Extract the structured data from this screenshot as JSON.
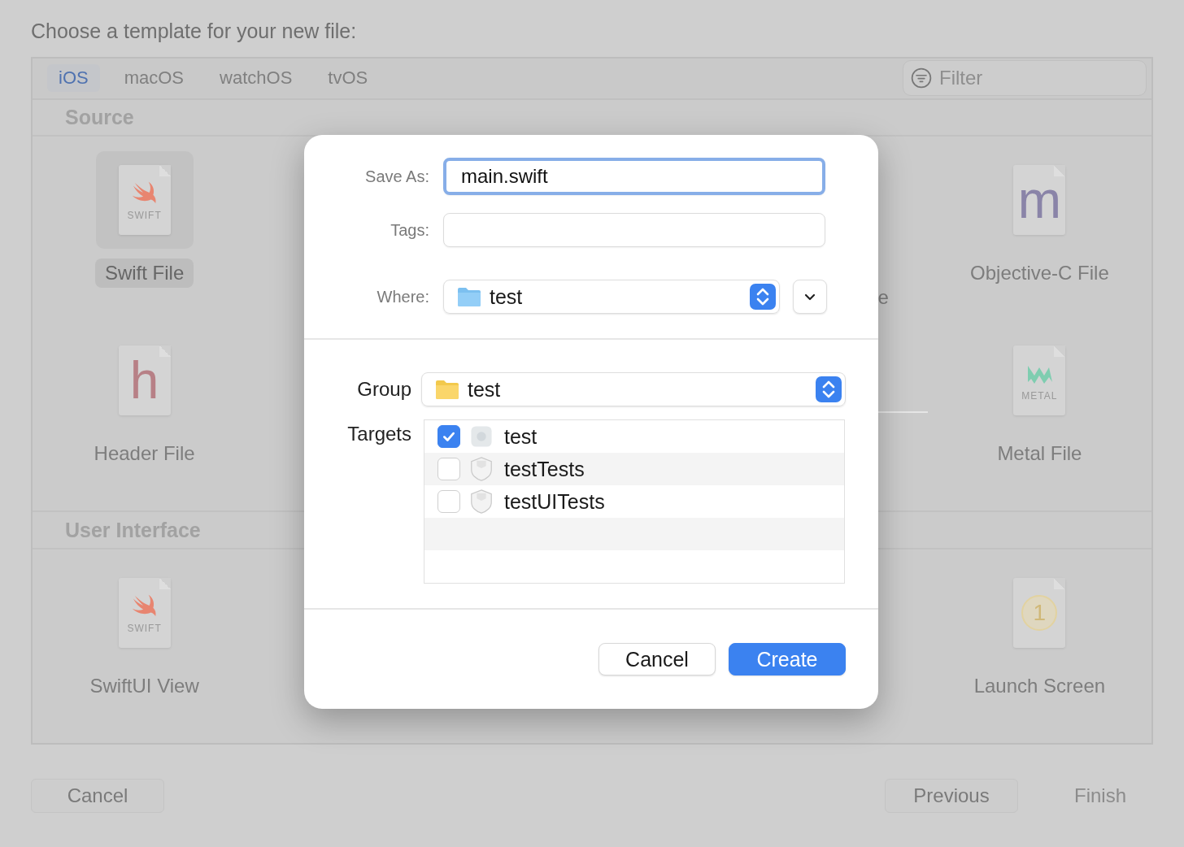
{
  "window": {
    "title": "Choose a template for your new file:"
  },
  "platform_tabs": [
    {
      "label": "iOS",
      "selected": true
    },
    {
      "label": "macOS",
      "selected": false
    },
    {
      "label": "watchOS",
      "selected": false
    },
    {
      "label": "tvOS",
      "selected": false
    }
  ],
  "filter": {
    "placeholder": "Filter"
  },
  "sections": [
    {
      "title": "Source",
      "rows": [
        [
          {
            "label": "Swift File",
            "selected": true,
            "icon": {
              "kind": "swift",
              "text": "SWIFT"
            }
          },
          "",
          "",
          {
            "label": "e",
            "selected": false,
            "icon": {
              "kind": "none"
            }
          },
          {
            "label": "Objective-C File",
            "selected": false,
            "icon": {
              "kind": "letter",
              "text": "m",
              "color": "#8a84a8"
            }
          }
        ],
        [
          {
            "label": "Header File",
            "selected": false,
            "icon": {
              "kind": "letter",
              "text": "h",
              "color": "#b78086"
            }
          },
          "",
          "",
          "",
          {
            "label": "Metal File",
            "selected": false,
            "icon": {
              "kind": "metal",
              "text": "METAL"
            }
          }
        ]
      ]
    },
    {
      "title": "User Interface",
      "rows": [
        [
          {
            "label": "SwiftUI View",
            "selected": false,
            "icon": {
              "kind": "swift",
              "text": "SWIFT"
            }
          },
          "",
          "",
          "",
          {
            "label": "Launch Screen",
            "selected": false,
            "icon": {
              "kind": "badge",
              "text": "1"
            }
          }
        ]
      ]
    }
  ],
  "footer": {
    "left_buttons": [
      {
        "label": "Cancel",
        "disabled": false
      }
    ],
    "right_buttons": [
      {
        "label": "Previous",
        "disabled": false
      },
      {
        "label": "Finish",
        "disabled": true
      }
    ]
  },
  "save_sheet": {
    "save_as": {
      "label": "Save As:",
      "value": "main.swift",
      "focused": true
    },
    "tags": {
      "label": "Tags:"
    },
    "where": {
      "label": "Where:",
      "value": "test",
      "expanded": false
    },
    "group": {
      "label": "Group",
      "value": "test"
    },
    "targets": {
      "label": "Targets",
      "items": [
        {
          "name": "test",
          "checked": true,
          "kind": "app"
        },
        {
          "name": "testTests",
          "checked": false,
          "kind": "test"
        },
        {
          "name": "testUITests",
          "checked": false,
          "kind": "test"
        }
      ]
    },
    "buttons": [
      {
        "label": "Cancel",
        "default": false
      },
      {
        "label": "Create",
        "default": true
      }
    ]
  }
}
